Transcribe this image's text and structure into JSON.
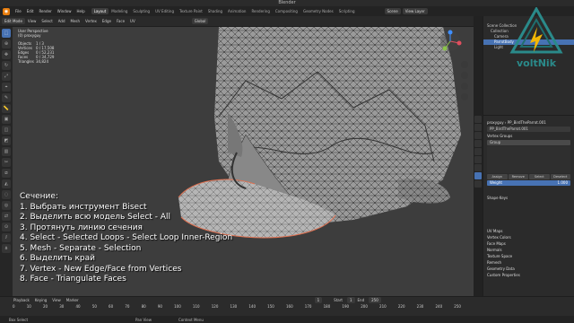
{
  "app": {
    "title": "Blender"
  },
  "topbar": {
    "menus": [
      "File",
      "Edit",
      "Render",
      "Window",
      "Help"
    ],
    "workspaces": [
      "Layout",
      "Modeling",
      "Sculpting",
      "UV Editing",
      "Texture Paint",
      "Shading",
      "Animation",
      "Rendering",
      "Compositing",
      "Geometry Nodes",
      "Scripting"
    ],
    "scene": "Scene",
    "view_layer": "View Layer"
  },
  "header": {
    "mode": "Edit Mode",
    "menus": [
      "View",
      "Select",
      "Add",
      "Mesh",
      "Vertex",
      "Edge",
      "Face",
      "UV"
    ],
    "transform": "Global"
  },
  "overlay": {
    "view": "User Perspective",
    "object": "(0) proxyguy",
    "stats": [
      [
        "Objects",
        "1 / 3"
      ],
      [
        "Vertices",
        "0 / 17,508"
      ],
      [
        "Edges",
        "0 / 52,231"
      ],
      [
        "Faces",
        "0 / 34,729"
      ],
      [
        "Triangles",
        "34,824"
      ]
    ]
  },
  "caption": {
    "lines": [
      "Сечение:",
      "1. Выбрать инструмент Bisect",
      "2. Выделить всю модель Select - All",
      "3. Протянуть линию сечения",
      "4. Select - Selected Loops - Select Loop Inner-Region",
      "5. Mesh - Separate - Selection",
      "6. Выделить край",
      "7. Vertex - New Edge/Face from Vertices",
      "8. Face - Triangulate Faces"
    ]
  },
  "outliner": {
    "title": "Scene Collection",
    "rows": [
      "Collection",
      "Camera",
      "ParrotBody",
      "Light"
    ]
  },
  "logo": {
    "text": "voltNik"
  },
  "properties": {
    "object": "proxyguy",
    "mesh": "PP_BirdTheParrot.001",
    "datablock": "PP_BirdTheParrot.001",
    "sections": [
      "Vertex Groups",
      "Shape Keys",
      "UV Maps",
      "Vertex Colors",
      "Face Maps",
      "Normals",
      "Texture Space",
      "Remesh",
      "Geometry Data",
      "Custom Properties"
    ],
    "group": "Group",
    "buttons": [
      "Assign",
      "Remove",
      "Select",
      "Deselect"
    ],
    "weight_label": "Weight",
    "weight_value": "1.000"
  },
  "timeline": {
    "menus": [
      "Playback",
      "Keying",
      "View",
      "Marker"
    ],
    "frame": "1",
    "start_label": "Start",
    "start": "1",
    "end_label": "End",
    "end": "250",
    "ticks": [
      "0",
      "10",
      "20",
      "30",
      "40",
      "50",
      "60",
      "70",
      "80",
      "90",
      "100",
      "110",
      "120",
      "130",
      "140",
      "150",
      "160",
      "170",
      "180",
      "190",
      "200",
      "210",
      "220",
      "230",
      "240",
      "250"
    ]
  },
  "status": {
    "items": [
      "Box Select",
      "Pan View",
      "Context Menu"
    ]
  }
}
